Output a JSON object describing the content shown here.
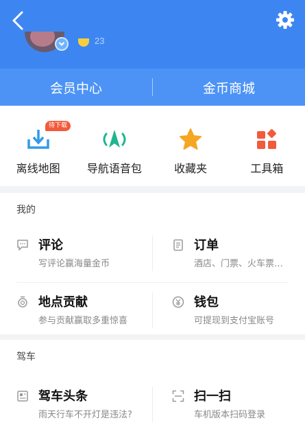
{
  "header": {
    "back_icon": "chevron-left-icon",
    "settings_icon": "gear-icon",
    "coin_count": "23",
    "colors": {
      "header_bg": "#3d86f2",
      "member_bar_bg": "#4d93f5"
    }
  },
  "member_bar": {
    "left_label": "会员中心",
    "right_label": "金币商城"
  },
  "tools": [
    {
      "label": "离线地图",
      "icon": "download-icon",
      "badge": "待下载"
    },
    {
      "label": "导航语音包",
      "icon": "navigation-voice-icon"
    },
    {
      "label": "收藏夹",
      "icon": "star-icon"
    },
    {
      "label": "工具箱",
      "icon": "toolbox-icon"
    }
  ],
  "mine": {
    "title": "我的",
    "items": [
      {
        "title": "评论",
        "subtitle": "写评论赢海量金币",
        "icon": "comment-icon"
      },
      {
        "title": "订单",
        "subtitle": "酒店、门票、火车票…",
        "icon": "order-icon"
      },
      {
        "title": "地点贡献",
        "subtitle": "参与贡献赢取多重惊喜",
        "icon": "location-contribution-icon"
      },
      {
        "title": "钱包",
        "subtitle": "可提现到支付宝账号",
        "icon": "wallet-icon"
      }
    ]
  },
  "driving": {
    "title": "驾车",
    "items": [
      {
        "title": "驾车头条",
        "subtitle": "雨天行车不开灯是违法?",
        "icon": "news-icon"
      },
      {
        "title": "扫一扫",
        "subtitle": "车机版本扫码登录",
        "icon": "scan-icon"
      }
    ]
  }
}
